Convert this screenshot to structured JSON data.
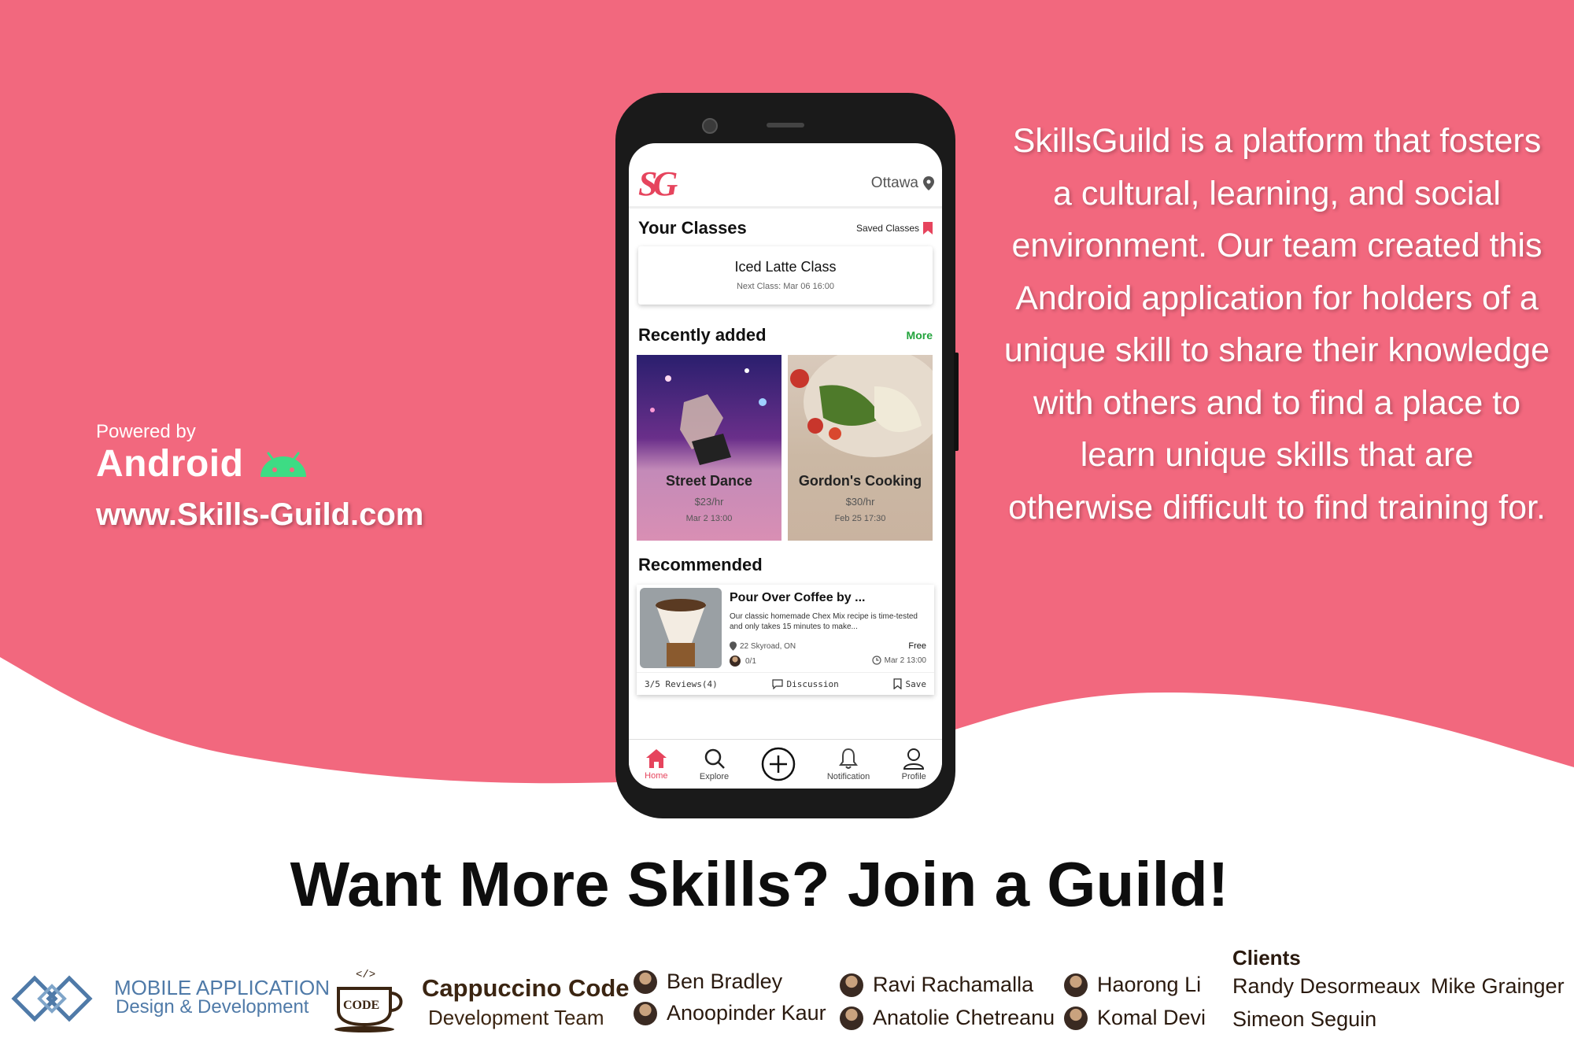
{
  "colors": {
    "brand_pink": "#f2687e",
    "accent": "#e6445d",
    "more_green": "#22a33c"
  },
  "left_panel": {
    "powered_by": "Powered by",
    "platform": "Android",
    "website": "www.Skills-Guild.com"
  },
  "about_text": "SkillsGuild is a platform that fosters a cultural, learning, and social environment. Our team created this Android application for holders of a unique skill to share their knowledge with others and to find a place to learn unique skills that are otherwise difficult to find training for.",
  "headline": "Want More Skills? Join a Guild!",
  "app": {
    "logo": "SG",
    "location": "Ottawa",
    "your_classes": {
      "title": "Your Classes",
      "saved_link": "Saved Classes",
      "card": {
        "name": "Iced Latte Class",
        "next": "Next Class: Mar 06 16:00"
      }
    },
    "recently_added": {
      "title": "Recently added",
      "more": "More",
      "items": [
        {
          "name": "Street Dance",
          "price": "$23/hr",
          "date": "Mar 2 13:00"
        },
        {
          "name": "Gordon's Cooking",
          "price": "$30/hr",
          "date": "Feb 25 17:30"
        }
      ]
    },
    "recommended": {
      "title": "Recommended",
      "card": {
        "title": "Pour Over Coffee by ...",
        "description": "Our classic homemade Chex Mix recipe is time-tested and only takes 15 minutes to make...",
        "location": "22 Skyroad, ON",
        "price": "Free",
        "seats": "0/1",
        "time": "Mar 2 13:00",
        "reviews": "3/5 Reviews(4)",
        "discussion": "Discussion",
        "save": "Save"
      }
    },
    "nav": [
      {
        "label": "Home",
        "icon": "home-icon"
      },
      {
        "label": "Explore",
        "icon": "search-icon"
      },
      {
        "label": "",
        "icon": "add-circle-icon"
      },
      {
        "label": "Notification",
        "icon": "bell-icon"
      },
      {
        "label": "Profile",
        "icon": "person-icon"
      }
    ]
  },
  "footer": {
    "mobile_app_line1": "MOBILE APPLICATION",
    "mobile_app_line2": "Design & Development",
    "team_name": "Cappuccino Code",
    "team_sub": "Development Team",
    "code_badge": "CODE",
    "members": [
      "Ben Bradley",
      "Anoopinder Kaur",
      "Ravi Rachamalla",
      "Anatolie Chetreanu",
      "Haorong Li",
      "Komal Devi"
    ],
    "clients_title": "Clients",
    "clients": [
      "Randy Desormeaux",
      "Mike Grainger",
      "Simeon Seguin"
    ]
  }
}
